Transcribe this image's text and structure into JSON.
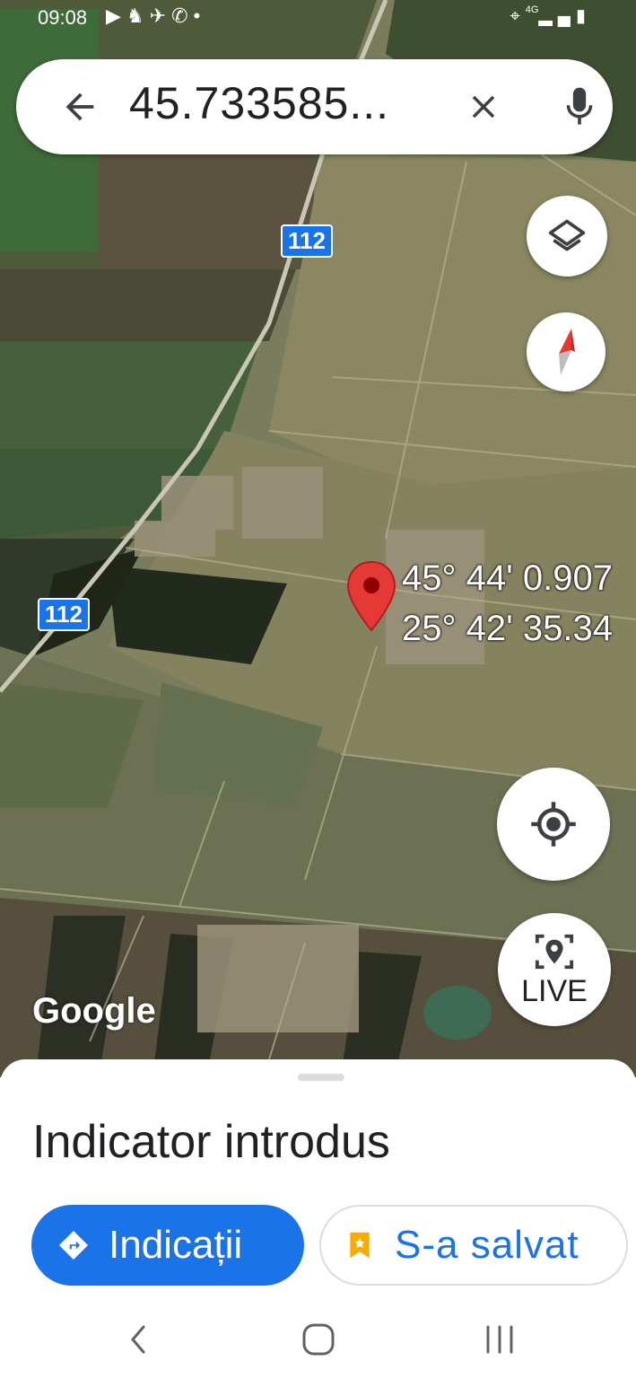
{
  "status_bar": {
    "time": "09:08",
    "left_icons": [
      "youtube-icon",
      "notification-icon",
      "plane-icon",
      "call-icon",
      "dot-icon"
    ],
    "network": "4G",
    "right_icons": [
      "location-icon",
      "signal-icon",
      "battery-icon"
    ]
  },
  "search": {
    "query": "45.733585...",
    "back_icon": "arrow-back-icon",
    "clear_icon": "close-icon",
    "mic_icon": "mic-icon"
  },
  "map": {
    "road_labels": [
      "112",
      "112"
    ],
    "coordinates": {
      "lat": "45° 44' 0.907",
      "lon": "25° 42' 35.34"
    },
    "logo": "Google"
  },
  "controls": {
    "layers_icon": "layers-icon",
    "compass_icon": "compass-icon",
    "locate_icon": "my-location-icon",
    "live_label": "LIVE"
  },
  "sheet": {
    "title": "Indicator introdus",
    "directions_label": "Indicații",
    "saved_label": "S-a salvat"
  },
  "colors": {
    "accent": "#1a73e8",
    "pin": "#e53935",
    "saved_icon": "#f9ab00"
  },
  "navbar": {
    "icons": [
      "back-icon",
      "home-icon",
      "recents-icon"
    ]
  }
}
